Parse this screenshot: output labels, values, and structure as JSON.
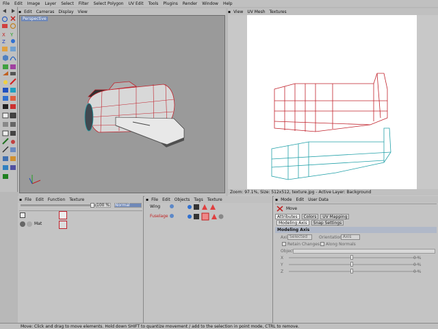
{
  "menubar": [
    "File",
    "Edit",
    "Image",
    "Layer",
    "Select",
    "Filter",
    "Select Polygon",
    "UV Edit",
    "Tools",
    "Plugins",
    "Render",
    "Window",
    "Help"
  ],
  "viewport": {
    "menu": [
      "Edit",
      "Cameras",
      "Display",
      "View"
    ],
    "label": "Perspective"
  },
  "uv": {
    "menu": [
      "View",
      "UV Mesh",
      "Textures"
    ],
    "status": "Zoom: 97.1%, Size: 512x512, texture.jpg - Active Layer: Background"
  },
  "material": {
    "menu": [
      "File",
      "Edit",
      "Function",
      "Texture"
    ],
    "percent": "100 %",
    "mode": "Normal",
    "mat_name": "Mat"
  },
  "objects": {
    "menu": [
      "File",
      "Edit",
      "Objects",
      "Tags",
      "Texture"
    ],
    "items": [
      "Wing",
      "Fuselage"
    ]
  },
  "attributes": {
    "menu": [
      "Mode",
      "Edit",
      "User Data"
    ],
    "tool_name": "Move",
    "tabs": [
      "Attributes",
      "Colors",
      "UV Mapping"
    ],
    "subtabs": [
      "Modeling Axis",
      "Snap Settings"
    ],
    "section": "Modeling Axis",
    "axis_label": "Axis",
    "axis_value": "Selected",
    "orientation_label": "Orientation",
    "orientation_value": "Axis",
    "retain_changes": "Retain Changes",
    "along_normals": "Along Normals",
    "object_label": "Object",
    "x_label": "X",
    "y_label": "Y",
    "z_label": "Z",
    "x_val": "0 %",
    "y_val": "0 %",
    "z_val": "0 %"
  },
  "statusbar": "Move: Click and drag to move elements. Hold down SHIFT to quantize movement / add to the selection in point mode, CTRL to remove.",
  "colors": {
    "fuselage_wire": "#c0202a",
    "wing_wire": "#20a0a8"
  }
}
